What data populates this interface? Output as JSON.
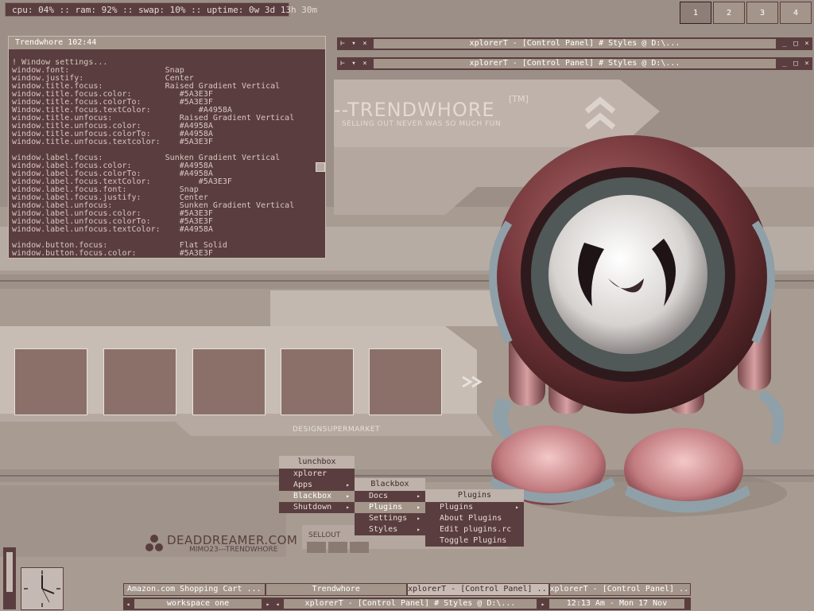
{
  "statusbar": {
    "text": "cpu: 04% :: ram: 92% :: swap: 10% :: uptime: 0w 3d 13h 30m"
  },
  "workspaces": [
    "1",
    "2",
    "3",
    "4"
  ],
  "terminal": {
    "title": "Trendwhore  102:44",
    "lines": [
      "! Window settings...",
      "window.font:                    Snap",
      "window.justify:                 Center",
      "window.title.focus:             Raised Gradient Vertical",
      "window.title.focus.color:          #5A3E3F",
      "window.title.focus.colorTo:        #5A3E3F",
      "Window.title.focus.textColor:          #A4958A",
      "window.title.unfocus:              Raised Gradient Vertical",
      "window.title.unfocus.color:        #A4958A",
      "window.title.unfocus.colorTo:      #A4958A",
      "window.title.unfocus.textcolor:    #5A3E3F",
      "",
      "window.label.focus:             Sunken Gradient Vertical",
      "window.label.focus.color:          #A4958A",
      "window.label.focus.colorTo:        #A4958A",
      "window.label.focus.textColor:          #5A3E3F",
      "window.label.focus.font:           Snap",
      "window.label.focus.justify:        Center",
      "window.label.unfocus:              Sunken Gradient Vertical",
      "window.label.unfocus.color:        #5A3E3F",
      "window.label.unfocus.colorTo:      #5A3E3F",
      "window.label.unfocus.textColor:    #A4958A",
      "",
      "window.button.focus:               Flat Solid",
      "window.button.focus.color:         #5A3E3F"
    ]
  },
  "explorer": {
    "title1": "xplorerT - [Control Panel] # Styles @ D:\\...",
    "title2": "xplorerT - [Control Panel] # Styles @ D:\\...",
    "btn_left": [
      "⊢",
      "▾",
      "×"
    ],
    "btn_right": [
      "_",
      "□",
      "×"
    ]
  },
  "branding": {
    "logo": "--TRENDWHORE",
    "tm": "[TM]",
    "tagline": "SELLING OUT NEVER WAS SO MUCH FUN",
    "designer": "DESIGNSUPERMARKET",
    "site": "DEADDREAMER.COM",
    "credit": "MIMO23---TRENDWHORE",
    "sellout": "SELLOUT"
  },
  "menus": {
    "root": {
      "title": "lunchbox",
      "items": [
        "xplorer",
        "Apps",
        "Blackbox",
        "Shutdown"
      ],
      "arrows": [
        "",
        "▸",
        "▸",
        "▸"
      ]
    },
    "blackbox": {
      "title": "Blackbox",
      "items": [
        "Docs",
        "Plugins",
        "Settings",
        "Styles"
      ],
      "arrows": [
        "▸",
        "▸",
        "▸",
        "▸"
      ]
    },
    "plugins": {
      "title": "Plugins",
      "items": [
        "Plugins",
        "About Plugins",
        "Edit plugins.rc",
        "Toggle Plugins"
      ],
      "arrows": [
        "▸",
        "",
        "",
        ""
      ]
    }
  },
  "taskbar": {
    "tasks": [
      "Amazon.com Shopping Cart ...",
      "Trendwhore",
      "xplorerT - [Control Panel] ...",
      "xplorerT - [Control Panel] ..."
    ],
    "workspace": "workspace one",
    "window": "xplorerT - [Control Panel] # Styles @ D:\\...",
    "clock": "12:13 Am - Mon 17 Nov",
    "nav_prev": "◂",
    "nav_next": "▸"
  },
  "colors": {
    "dark": "#5A3E3F",
    "light": "#A4958A"
  }
}
